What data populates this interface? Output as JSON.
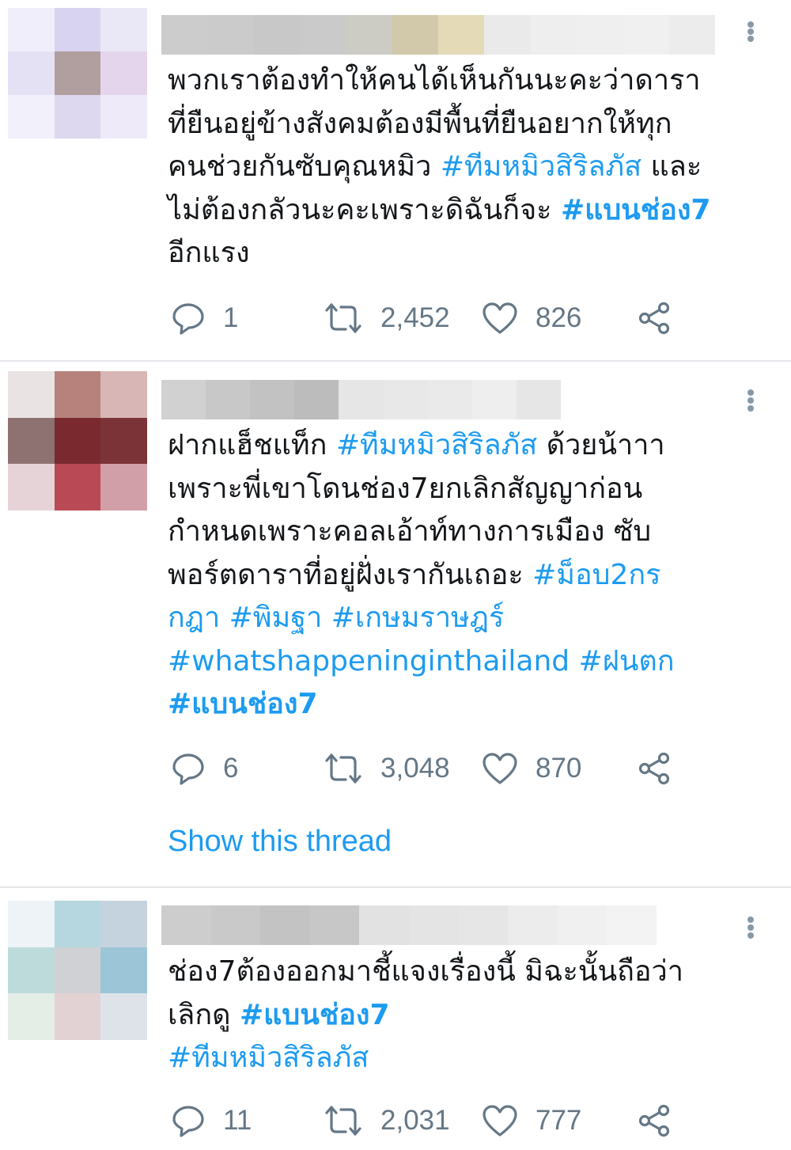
{
  "tweets": [
    {
      "lines": [
        [
          {
            "t": "พวกเราต้องทำให้คนได้เห็นกันนะคะว่าดารา"
          }
        ],
        [
          {
            "t": "ที่ยืนอยู่ข้างสังคมต้องมีพื้นที่ยืนอยากให้ทุก"
          }
        ],
        [
          {
            "t": "คนช่วยกันซับคุณหมิว "
          },
          {
            "t": "#ทีมหมิวสิริลภัส",
            "tag": true
          },
          {
            "t": " และ"
          }
        ],
        [
          {
            "t": "ไม่ต้องกลัวนะคะเพราะดิฉันก็จะ "
          },
          {
            "t": "#แบนช่อง7",
            "tag": true,
            "bold": true
          }
        ],
        [
          {
            "t": "อีกแรง"
          }
        ]
      ],
      "replies": "1",
      "retweets": "2,452",
      "likes": "826"
    },
    {
      "lines": [
        [
          {
            "t": "ฝากแฮ็ชแท็ก "
          },
          {
            "t": "#ทีมหมิวสิริลภัส",
            "tag": true
          },
          {
            "t": " ด้วยน้าาา"
          }
        ],
        [
          {
            "t": "เพราะพี่เขาโดนช่อง7ยกเลิกสัญญาก่อน"
          }
        ],
        [
          {
            "t": "กำหนดเพราะคอลเอ้าท์ทางการเมือง ซับ"
          }
        ],
        [
          {
            "t": "พอร์ตดาราที่อยู่ฝั่งเรากันเถอะ "
          },
          {
            "t": "#ม็อบ2กร",
            "tag": true
          }
        ],
        [
          {
            "t": "กฎา #พิมฐา #เกษมราษฎร์",
            "tag": true
          }
        ],
        [
          {
            "t": "#whatshappeninginthailand #ฝนตก",
            "tag": true
          }
        ],
        [
          {
            "t": "#แบนช่อง7",
            "tag": true,
            "bold": true
          }
        ]
      ],
      "replies": "6",
      "retweets": "3,048",
      "likes": "870",
      "show_thread": "Show this thread"
    },
    {
      "lines": [
        [
          {
            "t": "ช่อง7ต้องออกมาชี้แจงเรื่องนี้ มิฉะนั้นถือว่า"
          }
        ],
        [
          {
            "t": "เลิกดู "
          },
          {
            "t": "#แบนช่อง7",
            "tag": true,
            "bold": true
          }
        ],
        [
          {
            "t": "#ทีมหมิวสิริลภัส",
            "tag": true
          }
        ]
      ],
      "replies": "11",
      "retweets": "2,031",
      "likes": "777"
    }
  ],
  "icons": {
    "reply": "reply-bubble-icon",
    "retweet": "retweet-arrows-icon",
    "like": "heart-icon",
    "share": "share-icon",
    "more": "more-vertical-icon"
  },
  "colors": {
    "link": "#1d9bf0",
    "text": "#14171a",
    "muted": "#657786",
    "divider": "#e3e7ea"
  },
  "avatars": [
    [
      "#efeefa",
      "#d7d3f1",
      "#eae8f7",
      "#e5e1f5",
      "#b19e9e",
      "#e5d5ec",
      "#f1f0fb",
      "#ddd7ef",
      "#eeeafa"
    ],
    [
      "#e9e3e3",
      "#b7827c",
      "#d8b6b6",
      "#8e7272",
      "#7a2a2f",
      "#7b3337",
      "#e6d3d7",
      "#b94955",
      "#d19fa7"
    ],
    [
      "#edf3f6",
      "#b6d7df",
      "#c4d3dd",
      "#bedbdc",
      "#d0d1d5",
      "#9dc5d8",
      "#e4ede6",
      "#e3d2d3",
      "#dee3ea"
    ]
  ],
  "name_bars": [
    [
      "#cccccc",
      "#cbcbcb",
      "#c8c8c8",
      "#cacaca",
      "#cccbc4",
      "#d2c9aa",
      "#e5dab8",
      "#eaeaea",
      "#eeeeee",
      "#efefef",
      "#f0f0f0",
      "#ececec"
    ],
    [
      "#d1d1d1",
      "#c8c8c8",
      "#c2c2c2",
      "#bcbcbc",
      "#e6e6e6",
      "#e8e8e8",
      "#eaeaea",
      "#eeeeee",
      "#e6e6e6"
    ],
    [
      "#cdcdcd",
      "#c9c9c9",
      "#c3c3c3",
      "#c7c7c7",
      "#e2e2e2",
      "#e4e4e4",
      "#e6e6e6",
      "#ececec",
      "#f0f0f0",
      "#f3f3f3"
    ]
  ]
}
